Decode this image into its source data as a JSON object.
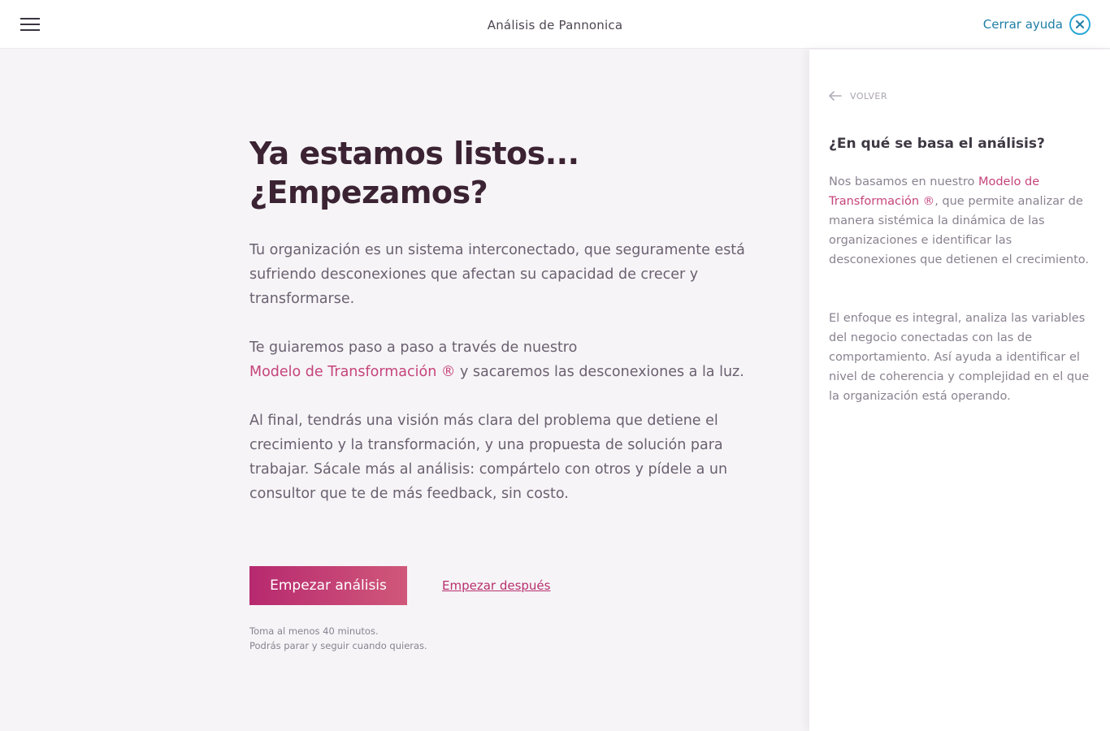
{
  "header": {
    "title": "Análisis de Pannonica",
    "close_help_label": "Cerrar ayuda",
    "menu_icon": "hamburger-icon",
    "close_icon": "close-circle-icon"
  },
  "main": {
    "headline_line1": "Ya estamos listos...",
    "headline_line2": "¿Empezamos?",
    "para1": "Tu organización es un sistema interconectado, que seguramente está sufriendo desconexiones que afectan su capacidad de crecer y transformarse.",
    "para2_start": "Te guiaremos paso a paso a través de nuestro",
    "para2_link": "Modelo de Transformación ®",
    "para2_end": " y sacaremos las desconexiones a la luz.",
    "para3": "Al final, tendrás una visión más clara del problema que detiene el crecimiento y la transformación, y una propuesta de solución para trabajar. Sácale más al análisis: compártelo con otros y pídele a un consultor que te de más feedback, sin costo.",
    "start_button": "Empezar análisis",
    "later_link": "Empezar después",
    "note_line1": "Toma al menos 40 minutos.",
    "note_line2": "Podrás parar y seguir cuando quieras."
  },
  "help": {
    "back_label": "VOLVER",
    "back_icon": "arrow-left-icon",
    "title": "¿En qué se basa el análisis?",
    "p1_start": "Nos basamos en nuestro ",
    "p1_link": "Modelo de Transformación ®",
    "p1_end": ", que permite analizar de manera sistémica la dinámica de las organizaciones e identificar las desconexiones que detienen el crecimiento.",
    "p2": "El enfoque es integral, analiza las variables del negocio conectadas con las de comportamiento. Así ayuda a identificar el nivel de coherencia y complejidad en el que la organización está operando."
  },
  "colors": {
    "accent": "#c5447b",
    "button_gradient_start": "#b7296f",
    "button_gradient_end": "#d0587a",
    "close_help": "#1f7ea6",
    "headline": "#3b2333"
  }
}
